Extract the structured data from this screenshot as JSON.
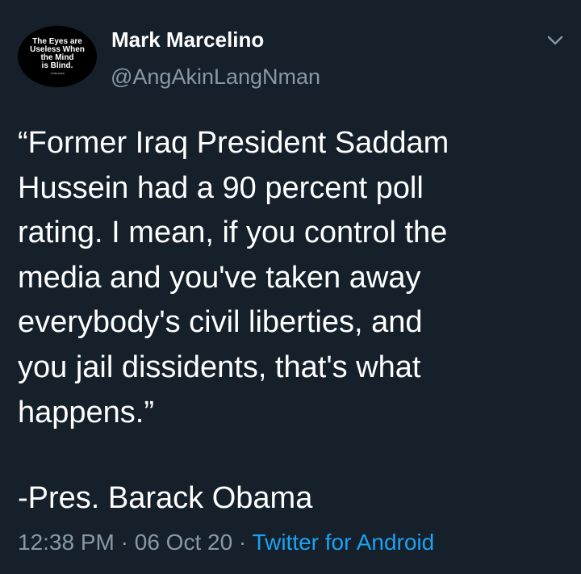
{
  "author": {
    "display_name": "Mark Marcelino",
    "handle": "@AngAkinLangNman",
    "avatar": {
      "lines": [
        "The Eyes are",
        "Useless When",
        "the Mind",
        "is Blind."
      ],
      "credit": "-Unknown"
    }
  },
  "menu_icon": "chevron-down-icon",
  "tweet": {
    "text_lines": [
      "“Former Iraq President Saddam",
      "Hussein had a 90 percent poll",
      "rating. I mean, if you control the",
      "media and you've taken away",
      "everybody's civil liberties, and",
      "you jail dissidents, that's what",
      "happens.”"
    ],
    "attribution": "-Pres. Barack Obama"
  },
  "meta": {
    "time": "12:38 PM",
    "date": "06 Oct 20",
    "separator": " · ",
    "source": "Twitter for Android"
  },
  "colors": {
    "background": "#15202b",
    "text": "#ffffff",
    "muted": "#8899a6",
    "link": "#1da1f2"
  }
}
